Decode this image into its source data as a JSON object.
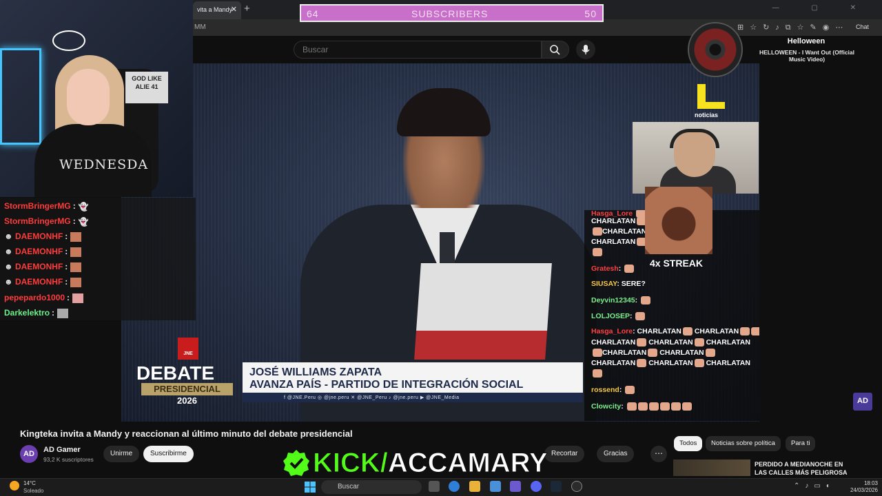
{
  "browser": {
    "tab_title": "vita a Mandy",
    "tab_close": "✕",
    "new_tab": "+",
    "address": "MM",
    "chat_label": "Chat"
  },
  "subscriber_goal": {
    "current": "64",
    "label": "SUBSCRIBERS",
    "target": "50",
    "color": "#c86fc9"
  },
  "youtube": {
    "search_placeholder": "Buscar",
    "video_title": "Kingteka invita a Mandy y reaccionan al último minuto del debate presidencial",
    "channel": {
      "name": "AD Gamer",
      "subs": "93,2 K suscriptores",
      "avatar": "AD"
    },
    "buttons": {
      "join": "Unirme",
      "subscribe": "Suscribirme",
      "clip": "Recortar",
      "thanks": "Gracias",
      "more": "⋯"
    },
    "chips": [
      "Todos",
      "Noticias sobre política",
      "Para ti"
    ],
    "recommended_title": "PERDIDO A MEDIANOCHE EN LAS CALLES MÁS PELIGROSA",
    "watermark": "AD"
  },
  "broadcast": {
    "jne": "JNE",
    "debate": "DEBATE",
    "presidencial": "PRESIDENCIAL",
    "year": "2026",
    "name": "JOSÉ WILLIAMS ZAPATA",
    "party": "AVANZA PAÍS - PARTIDO DE INTEGRACIÓN SOCIAL",
    "socials": "f @JNE.Peru    ◎ @jne.peru    ✕ @JNE_Peru    ♪ @jne.peru    ▶ @JNE_Media",
    "network_name": "noticias",
    "accent": "#c91c1c"
  },
  "streamer": {
    "shirt_text": "WEDNESDA",
    "poster": "GOD LIKE ALIE 41"
  },
  "chat_left": [
    {
      "user": "StormBringerMG",
      "color": "#ff3b3b",
      "badge": false
    },
    {
      "user": "StormBringerMG",
      "color": "#ff3b3b",
      "badge": false
    },
    {
      "user": "DAEMONHF",
      "color": "#ff3b3b",
      "badge": true
    },
    {
      "user": "DAEMONHF",
      "color": "#ff3b3b",
      "badge": true
    },
    {
      "user": "DAEMONHF",
      "color": "#ff3b3b",
      "badge": true
    },
    {
      "user": "DAEMONHF",
      "color": "#ff3b3b",
      "badge": true
    },
    {
      "user": "pepepardo1000",
      "color": "#ff3b3b",
      "badge": false
    },
    {
      "user": "Darkelektro",
      "color": "#6bf08a",
      "badge": false
    }
  ],
  "chat_right": {
    "charlatan": "CHARLATAN",
    "streak": "4x STREAK",
    "lines": [
      {
        "user": "Gratesh",
        "color": "#ff4040",
        "msg": ""
      },
      {
        "user": "SIUSAY",
        "color": "#f7c948",
        "msg": "SERE?"
      },
      {
        "user": "Deyvin12345",
        "color": "#7cf08c",
        "msg": ""
      },
      {
        "user": "LOLJOSEP",
        "color": "#7cf08c",
        "msg": ""
      },
      {
        "user": "rossend",
        "color": "#f7c948",
        "msg": ""
      },
      {
        "user": "Clowcity",
        "color": "#7cf08c",
        "msg": ""
      }
    ],
    "partial_users": [
      "Hasga_Lore",
      "Hasga_Lore"
    ]
  },
  "now_playing": {
    "artist": "Helloween",
    "track": "HELLOWEEN - I Want Out (Official Music Video)"
  },
  "kick": {
    "prefix": "KICK/",
    "channel": "ACCAMARY",
    "color": "#53fc18"
  },
  "taskbar": {
    "temp": "14°C",
    "condition": "Soleado",
    "search": "Buscar",
    "time": "18:03",
    "date": "24/03/2026"
  }
}
